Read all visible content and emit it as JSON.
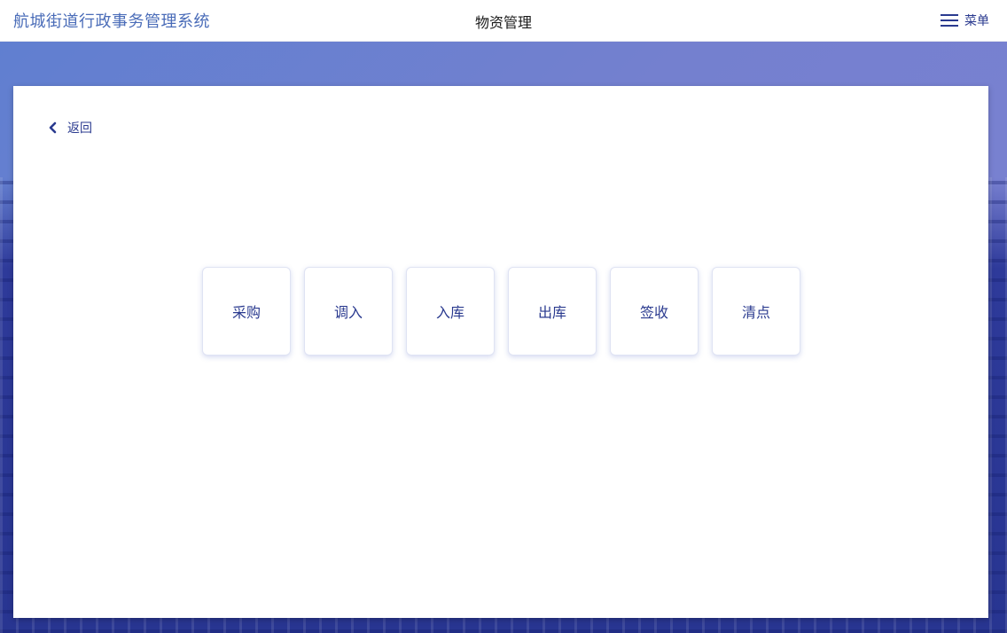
{
  "header": {
    "app_title": "航城街道行政事务管理系统",
    "page_title": "物资管理",
    "menu_label": "菜单"
  },
  "panel": {
    "back_label": "返回",
    "tiles": [
      {
        "label": "采购"
      },
      {
        "label": "调入"
      },
      {
        "label": "入库"
      },
      {
        "label": "出库"
      },
      {
        "label": "签收"
      },
      {
        "label": "清点"
      }
    ]
  },
  "colors": {
    "accent": "#2a3a8f",
    "title_blue": "#4a6cb8",
    "background_gradient_start": "#5f7fd0",
    "background_gradient_end": "#7d82d2"
  },
  "icons": {
    "menu": "hamburger-icon",
    "back": "chevron-left-icon"
  }
}
